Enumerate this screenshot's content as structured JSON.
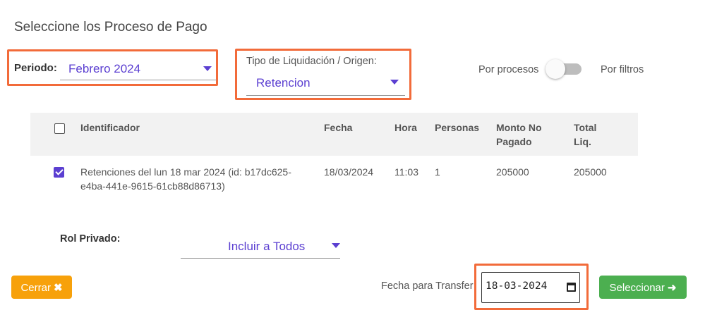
{
  "page_title": "Seleccione los Proceso de Pago",
  "periodo": {
    "label": "Periodo:",
    "value": "Febrero 2024"
  },
  "tipo": {
    "label": "Tipo de Liquidación / Origen:",
    "value": "Retencion"
  },
  "toggle": {
    "left_label": "Por procesos",
    "right_label": "Por filtros",
    "state": "off"
  },
  "table": {
    "headers": {
      "identificador": "Identificador",
      "fecha": "Fecha",
      "hora": "Hora",
      "personas": "Personas",
      "monto_line1": "Monto No",
      "monto_line2": "Pagado",
      "total_line1": "Total",
      "total_line2": "Liq."
    },
    "rows": [
      {
        "checked": true,
        "identificador_line1": "Retenciones del lun 18 mar 2024 (id: b17dc625-",
        "identificador_line2": "e4ba-441e-9615-61cb88d86713)",
        "fecha": "18/03/2024",
        "hora": "11:03",
        "personas": "1",
        "monto_no_pagado": "205000",
        "total_liq": "205000"
      }
    ]
  },
  "rol_privado": {
    "label": "Rol Privado:",
    "value": "Incluir a Todos"
  },
  "footer": {
    "cerrar_label": "Cerrar",
    "cerrar_icon": "✖",
    "fecha_transfer_label": "Fecha para Transfer",
    "fecha_transfer_value": "18-03-2024",
    "seleccionar_label": "Seleccionar",
    "seleccionar_icon": "➜"
  },
  "colors": {
    "accent": "#5b3fd1",
    "highlight": "#f26b3a",
    "warning": "#f7a10b",
    "success": "#4caf50"
  }
}
